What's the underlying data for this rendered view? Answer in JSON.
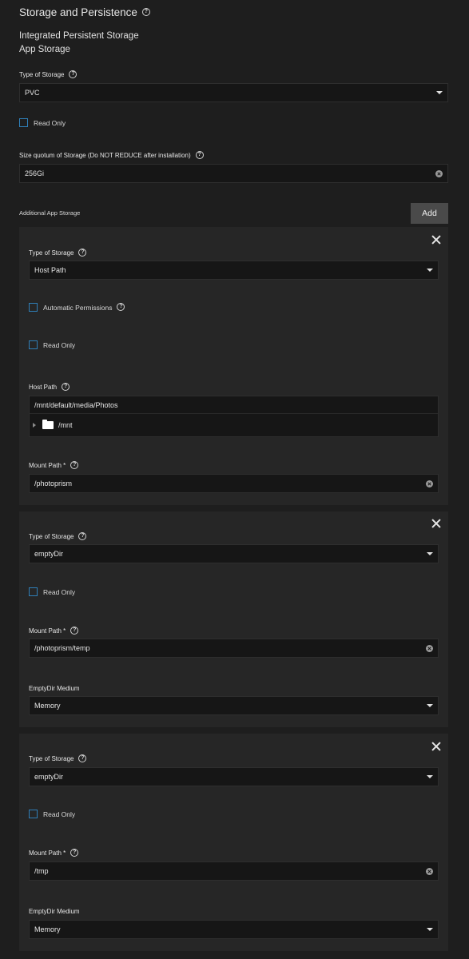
{
  "section": {
    "title": "Storage and Persistence"
  },
  "main_storage": {
    "title_line1": "Integrated Persistent Storage",
    "title_line2": "App Storage",
    "type_label": "Type of Storage",
    "type_value": "PVC",
    "read_only_label": "Read Only",
    "size_label": "Size quotum of Storage (Do NOT REDUCE after installation)",
    "size_value": "256Gi"
  },
  "additional": {
    "label": "Additional App Storage",
    "add_label": "Add"
  },
  "cards": [
    {
      "type_label": "Type of Storage",
      "type_value": "Host Path",
      "auto_perm_label": "Automatic Permissions",
      "read_only_label": "Read Only",
      "host_path_label": "Host Path",
      "host_path_value": "/mnt/default/media/Photos",
      "tree_node": "/mnt",
      "mount_label": "Mount Path *",
      "mount_value": "/photoprism"
    },
    {
      "type_label": "Type of Storage",
      "type_value": "emptyDir",
      "read_only_label": "Read Only",
      "mount_label": "Mount Path *",
      "mount_value": "/photoprism/temp",
      "medium_label": "EmptyDir Medium",
      "medium_value": "Memory"
    },
    {
      "type_label": "Type of Storage",
      "type_value": "emptyDir",
      "read_only_label": "Read Only",
      "mount_label": "Mount Path *",
      "mount_value": "/tmp",
      "medium_label": "EmptyDir Medium",
      "medium_value": "Memory"
    }
  ],
  "icons": {
    "help": "help-circle-icon",
    "clear": "clear-icon",
    "dropdown": "caret-down-icon",
    "close": "close-icon",
    "folder": "folder-icon",
    "expand": "triangle-right-icon"
  },
  "colors": {
    "background": "#1e1e1e",
    "card": "#262626",
    "field": "#161616",
    "checkbox_border": "#2f7fb8",
    "add_button": "#4a4a4a"
  }
}
